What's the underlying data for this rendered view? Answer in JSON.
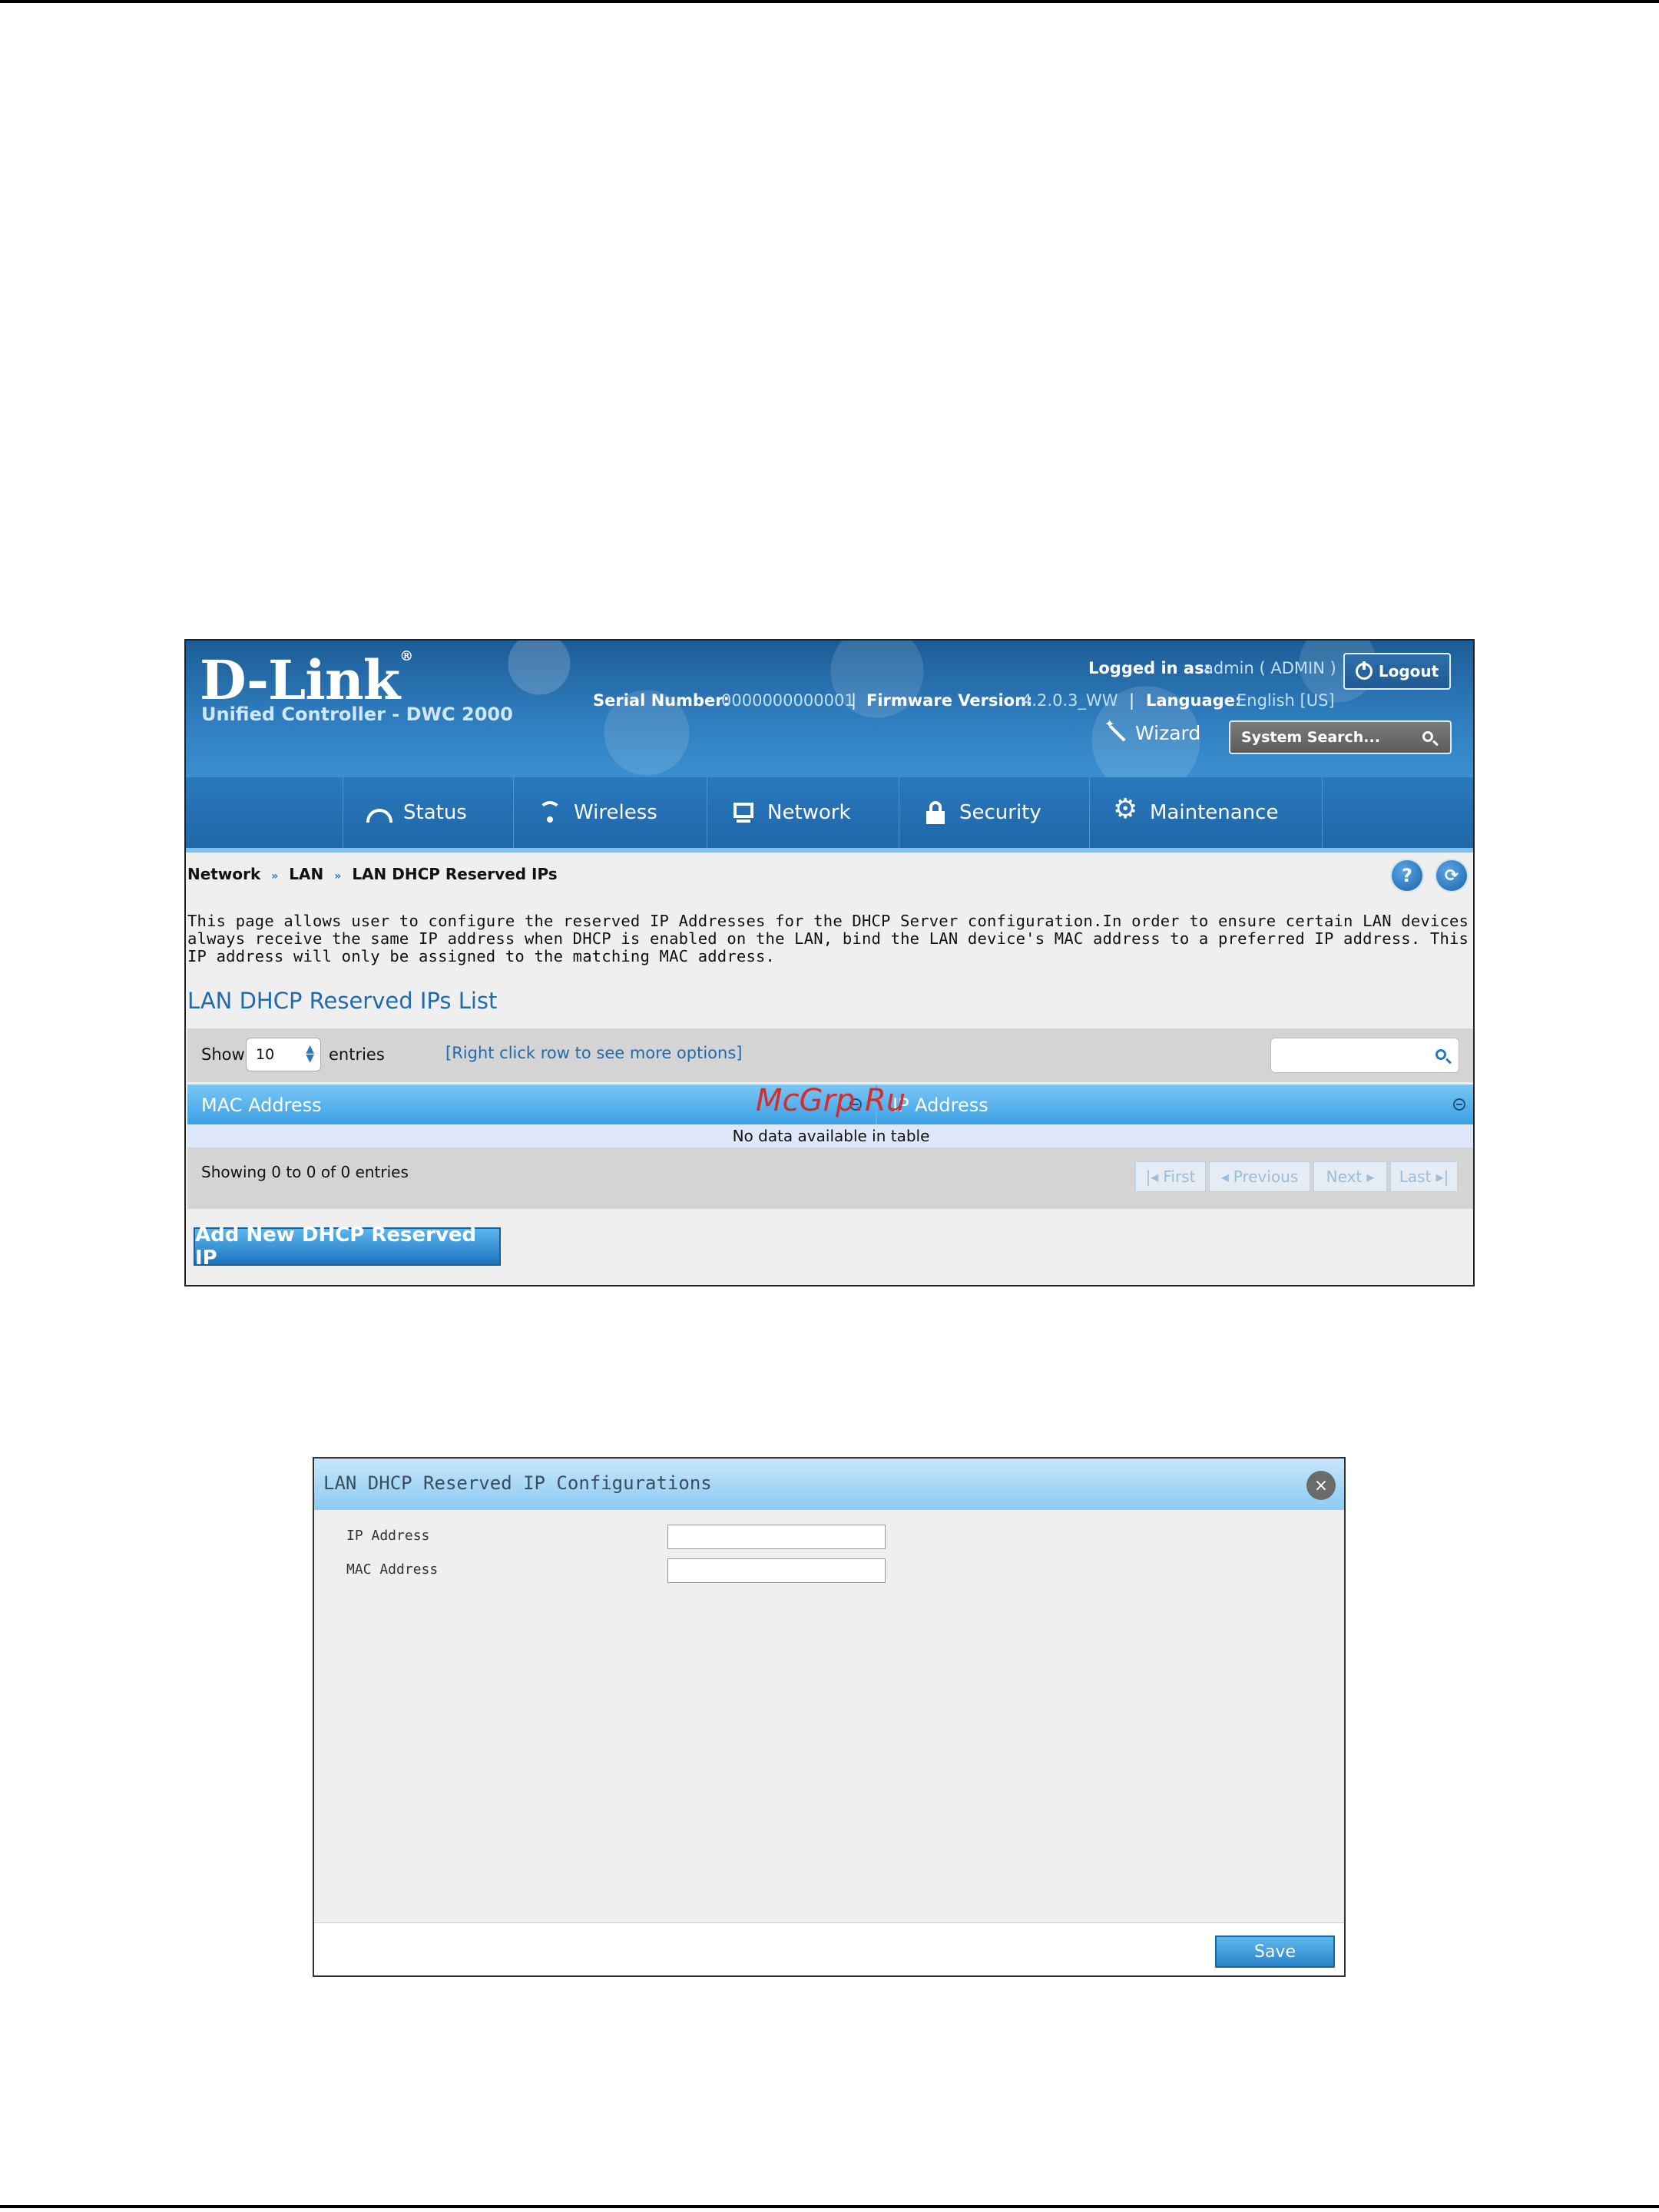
{
  "screenshot1": {
    "brand": {
      "logo": "D-Link",
      "registered": "®",
      "product": "Unified Controller - DWC 2000"
    },
    "header": {
      "logged_in_label": "Logged in as:",
      "logged_in_user": "admin ( ADMIN )",
      "logout_label": "Logout",
      "serial_label": "Serial Number:",
      "serial_value": "0000000000001",
      "firmware_label": "Firmware Version:",
      "firmware_value": "4.2.0.3_WW",
      "language_label": "Language:",
      "language_value": "English [US]",
      "separator": "|",
      "wizard_label": "Wizard",
      "search_placeholder": "System Search..."
    },
    "nav": {
      "items": [
        {
          "label": "Status",
          "icon": "gauge-icon"
        },
        {
          "label": "Wireless",
          "icon": "wifi-icon"
        },
        {
          "label": "Network",
          "icon": "monitor-icon"
        },
        {
          "label": "Security",
          "icon": "lock-icon"
        },
        {
          "label": "Maintenance",
          "icon": "gear-icon"
        }
      ]
    },
    "breadcrumb": {
      "items": [
        "Network",
        "LAN",
        "LAN DHCP Reserved IPs"
      ],
      "separator": "»"
    },
    "help_icon_glyph": "?",
    "refresh_icon_glyph": "⟳",
    "description": "This page allows user to configure the reserved IP Addresses for the DHCP Server configuration.In order to ensure certain LAN devices always receive the same IP address when DHCP is enabled on the LAN, bind the LAN device's MAC address to a preferred IP address. This IP address will only be assigned to the matching MAC address.",
    "list_title": "LAN DHCP Reserved IPs List",
    "toolbar": {
      "show_label": "Show",
      "entries_value": "10",
      "entries_label": "entries",
      "hint": "[Right click row to see more options]"
    },
    "table": {
      "columns": [
        "MAC Address",
        "IP Address"
      ],
      "empty_message": "No data available in table",
      "showing": "Showing 0 to 0 of 0 entries",
      "pagination": [
        "First",
        "Previous",
        "Next",
        "Last"
      ]
    },
    "add_button": "Add New DHCP Reserved IP",
    "watermark": "McGrp.Ru",
    "colors": {
      "header_blue": "#2f7cbd",
      "accent_blue": "#1e6bb0",
      "table_header": "#3aa0e4"
    }
  },
  "screenshot2": {
    "dialog_title": "LAN DHCP Reserved IP Configurations",
    "close_glyph": "×",
    "fields": [
      {
        "label": "IP Address",
        "value": ""
      },
      {
        "label": "MAC Address",
        "value": ""
      }
    ],
    "save_label": "Save"
  }
}
